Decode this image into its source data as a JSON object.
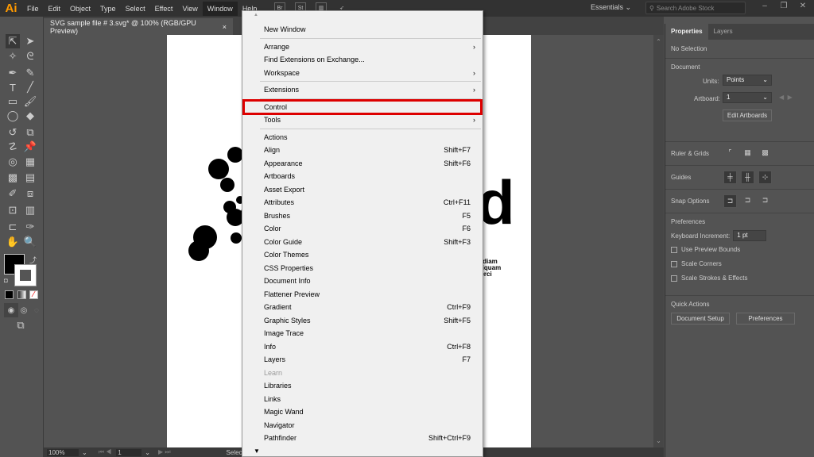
{
  "app": {
    "logo": "Ai",
    "colors": {
      "accent": "#ff9a00",
      "highlight": "#dd0000"
    }
  },
  "menubar": {
    "items": [
      "File",
      "Edit",
      "Object",
      "Type",
      "Select",
      "Effect",
      "View",
      "Window",
      "Help"
    ],
    "active": "Window",
    "icons": [
      "bridge-icon",
      "stock-icon",
      "arrange-documents-icon",
      "gpu-performance-icon"
    ],
    "icon_labels": [
      "Br",
      "St",
      "",
      ""
    ],
    "workspace": "Essentials",
    "search_placeholder": "Search Adobe Stock",
    "window_controls": [
      "minimize",
      "restore",
      "close"
    ]
  },
  "document_tab": {
    "title": "SVG sample file # 3.svg* @ 100% (RGB/GPU Preview)",
    "close": "×"
  },
  "window_menu": {
    "items": [
      {
        "label": "New Window",
        "shortcut": "",
        "submenu": false
      },
      {
        "sep": true
      },
      {
        "label": "Arrange",
        "shortcut": "",
        "submenu": true
      },
      {
        "label": "Find Extensions on Exchange...",
        "shortcut": "",
        "submenu": false
      },
      {
        "label": "Workspace",
        "shortcut": "",
        "submenu": true
      },
      {
        "sep": true
      },
      {
        "label": "Extensions",
        "shortcut": "",
        "submenu": true
      },
      {
        "sep": true
      },
      {
        "label": "Control",
        "shortcut": "",
        "submenu": false,
        "highlighted": true
      },
      {
        "label": "Tools",
        "shortcut": "",
        "submenu": true
      },
      {
        "sep": true
      },
      {
        "label": "Actions",
        "shortcut": ""
      },
      {
        "label": "Align",
        "shortcut": "Shift+F7"
      },
      {
        "label": "Appearance",
        "shortcut": "Shift+F6"
      },
      {
        "label": "Artboards",
        "shortcut": ""
      },
      {
        "label": "Asset Export",
        "shortcut": ""
      },
      {
        "label": "Attributes",
        "shortcut": "Ctrl+F11"
      },
      {
        "label": "Brushes",
        "shortcut": "F5"
      },
      {
        "label": "Color",
        "shortcut": "F6"
      },
      {
        "label": "Color Guide",
        "shortcut": "Shift+F3"
      },
      {
        "label": "Color Themes",
        "shortcut": ""
      },
      {
        "label": "CSS Properties",
        "shortcut": ""
      },
      {
        "label": "Document Info",
        "shortcut": ""
      },
      {
        "label": "Flattener Preview",
        "shortcut": ""
      },
      {
        "label": "Gradient",
        "shortcut": "Ctrl+F9"
      },
      {
        "label": "Graphic Styles",
        "shortcut": "Shift+F5"
      },
      {
        "label": "Image Trace",
        "shortcut": ""
      },
      {
        "label": "Info",
        "shortcut": "Ctrl+F8"
      },
      {
        "label": "Layers",
        "shortcut": "F7"
      },
      {
        "label": "Learn",
        "shortcut": "",
        "disabled": true
      },
      {
        "label": "Libraries",
        "shortcut": ""
      },
      {
        "label": "Links",
        "shortcut": ""
      },
      {
        "label": "Magic Wand",
        "shortcut": ""
      },
      {
        "label": "Navigator",
        "shortcut": ""
      },
      {
        "label": "Pathfinder",
        "shortcut": "Shift+Ctrl+F9"
      }
    ],
    "scroll_up": "▲",
    "scroll_down": "▼"
  },
  "artboard": {
    "big_letter": "d",
    "text_lines": [
      "d diam",
      "aliquam",
      "xerci"
    ]
  },
  "status": {
    "zoom": "100%",
    "artboard": "1",
    "tool": "Selection"
  },
  "properties": {
    "tabs": [
      "Properties",
      "Layers"
    ],
    "active_tab": "Properties",
    "selection": "No Selection",
    "document": {
      "title": "Document",
      "units_label": "Units:",
      "units": "Points",
      "artboard_label": "Artboard:",
      "artboard": "1",
      "edit_artboards": "Edit Artboards"
    },
    "ruler_grids": "Ruler & Grids",
    "guides": "Guides",
    "snap_options": "Snap Options",
    "preferences": {
      "title": "Preferences",
      "kb_label": "Keyboard Increment:",
      "kb_value": "1 pt",
      "checkboxes": [
        {
          "label": "Use Preview Bounds",
          "checked": false
        },
        {
          "label": "Scale Corners",
          "checked": false
        },
        {
          "label": "Scale Strokes & Effects",
          "checked": false
        }
      ]
    },
    "quick_actions": {
      "title": "Quick Actions",
      "buttons": [
        "Document Setup",
        "Preferences"
      ]
    }
  }
}
